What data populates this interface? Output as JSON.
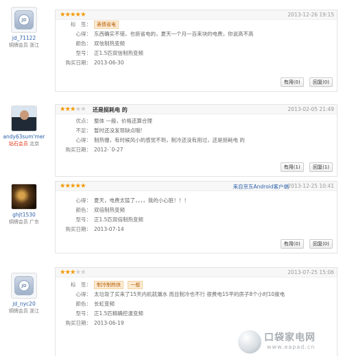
{
  "reviews": [
    {
      "user": "jd_71122",
      "level": "铜牌会员",
      "region": "浙江",
      "avatar": "jd-default-avatar",
      "stars": 5,
      "title": "",
      "client": "",
      "date": "2013-12-26 19:15",
      "tags": [
        "表情省电"
      ],
      "fields": [
        {
          "label": "心得：",
          "value": "东西确实不错，也挺省电的，夏天一个月一百来块的电费，你说高不高"
        },
        {
          "label": "颜色：",
          "value": "双信制热变频"
        },
        {
          "label": "型号：",
          "value": "正1.5匹双信制热变频"
        },
        {
          "label": "购买日期：",
          "value": "2013-06-30"
        }
      ],
      "useful": "有用(0)",
      "reply": "回复(0)"
    },
    {
      "user": "andy63sum'mer",
      "level": "钻石会员",
      "region": "北京",
      "avatar": "user-photo-avatar",
      "stars": 3,
      "title": "还是挺耗电 的",
      "client": "",
      "date": "2013-02-05 21:49",
      "tags": [],
      "fields": [
        {
          "label": "优点：",
          "value": "整体 一般，价格还算合理"
        },
        {
          "label": "不足：",
          "value": "暂时还没发现缺点哦!"
        },
        {
          "label": "心得：",
          "value": "制热慢，有时候风小的感觉不到，制冷还没有用过，还是挺耗电 的"
        },
        {
          "label": "购买日期：",
          "value": "2012-`0-27"
        }
      ],
      "useful": "有用(1)",
      "reply": "回复(1)"
    },
    {
      "user": "ghjt1530",
      "level": "铜牌会员",
      "region": "广东",
      "avatar": "dark-photo-avatar",
      "stars": 5,
      "title": "",
      "client": "来自京东Android客户端",
      "date": "2013-12-25 10:41",
      "tags": [],
      "fields": [
        {
          "label": "心得：",
          "value": "夏天，电费太猛了，，，，我的小心脏！！！"
        },
        {
          "label": "颜色：",
          "value": "双倍制热变频"
        },
        {
          "label": "型号：",
          "value": "正1.5匹双倍制热变频"
        },
        {
          "label": "购买日期：",
          "value": "2013-07-14"
        }
      ],
      "useful": "有用(0)",
      "reply": "回复(0)"
    },
    {
      "user": "jd_nyc20",
      "level": "铜牌会员",
      "region": "浙江",
      "avatar": "jd-default-avatar",
      "stars": 3,
      "title": "",
      "client": "",
      "date": "2013-07-25 15:06",
      "tags": [
        "制冷制热快",
        "一般"
      ],
      "fields": [
        {
          "label": "心得：",
          "value": "太垃圾了买来了15天内机就漏水 而且制冷也不行 很费电15平的房子8个小时10度电"
        },
        {
          "label": "颜色：",
          "value": "长虹变频"
        },
        {
          "label": "型号：",
          "value": "正1.5匹精确控温变频"
        },
        {
          "label": "购买日期：",
          "value": "2013-06-19"
        }
      ],
      "useful": "",
      "reply": ""
    }
  ],
  "tag_label": "标　签：",
  "watermark": {
    "title": "口袋家电网",
    "url": "www.eapad.cn"
  }
}
